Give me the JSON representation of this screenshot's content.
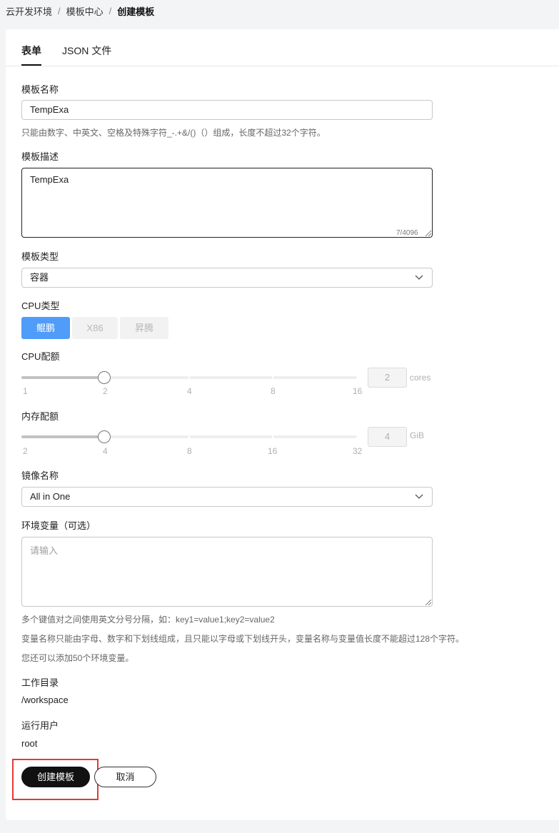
{
  "breadcrumb": {
    "items": [
      "云开发环境",
      "模板中心",
      "创建模板"
    ],
    "separator": "/"
  },
  "tabs": [
    {
      "label": "表单",
      "active": true
    },
    {
      "label": "JSON 文件",
      "active": false
    }
  ],
  "template_name": {
    "label": "模板名称",
    "value": "TempExa",
    "hint": "只能由数字、中英文、空格及特殊字符_-.+&/()（）组成，长度不超过32个字符。"
  },
  "template_description": {
    "label": "模板描述",
    "value": "TempExa",
    "counter": "7/4096"
  },
  "template_type": {
    "label": "模板类型",
    "value": "容器"
  },
  "cpu_type": {
    "label": "CPU类型",
    "options": [
      {
        "label": "鲲鹏",
        "state": "active"
      },
      {
        "label": "X86",
        "state": "disabled"
      },
      {
        "label": "昇腾",
        "state": "disabled"
      }
    ]
  },
  "cpu_quota": {
    "label": "CPU配额",
    "ticks": [
      "1",
      "2",
      "4",
      "8",
      "16"
    ],
    "value": "2",
    "unit": "cores",
    "selected_index": 1
  },
  "memory_quota": {
    "label": "内存配额",
    "ticks": [
      "2",
      "4",
      "8",
      "16",
      "32"
    ],
    "value": "4",
    "unit": "GiB",
    "selected_index": 1
  },
  "image_name": {
    "label": "镜像名称",
    "value": "All in One"
  },
  "env_vars": {
    "label": "环境变量（可选）",
    "placeholder": "请输入",
    "hints": [
      "多个键值对之间使用英文分号分隔，如：key1=value1;key2=value2",
      "变量名称只能由字母、数字和下划线组成，且只能以字母或下划线开头，变量名称与变量值长度不能超过128个字符。",
      "您还可以添加50个环境变量。"
    ]
  },
  "work_dir": {
    "label": "工作目录",
    "value": "/workspace"
  },
  "run_user": {
    "label": "运行用户",
    "value": "root"
  },
  "actions": {
    "create_label": "创建模板",
    "cancel_label": "取消"
  },
  "colors": {
    "accent": "#4f9cf9",
    "primary_button": "#111111",
    "highlight": "#e53935"
  }
}
